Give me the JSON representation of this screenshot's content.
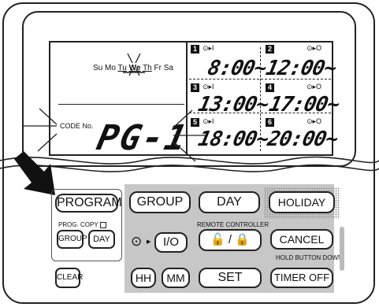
{
  "display": {
    "days": [
      "Su",
      "Mo",
      "Tu",
      "We",
      "Th",
      "Fr",
      "Sa"
    ],
    "code_label": "CODE No.",
    "program_code": "PG-1",
    "slots": [
      {
        "num": "1",
        "icon": "⊙▸I",
        "time": "8:00~"
      },
      {
        "num": "2",
        "icon": "⊙▸O",
        "time": "12:00~"
      },
      {
        "num": "3",
        "icon": "⊙▸I",
        "time": "13:00~"
      },
      {
        "num": "4",
        "icon": "⊙▸O",
        "time": "17:00~"
      },
      {
        "num": "5",
        "icon": "⊙▸I",
        "time": "18:00~"
      },
      {
        "num": "6",
        "icon": "⊙▸O",
        "time": "20:00~"
      }
    ]
  },
  "buttons": {
    "program": "PROGRAM",
    "prog_copy_label": "PROG. COPY",
    "group_small": "GROUP",
    "day_small": "DAY",
    "clear": "CLEAR",
    "group": "GROUP",
    "day": "DAY",
    "holiday": "HOLIDAY",
    "remote_controller_label": "REMOTE CONTROLLER",
    "timer_io": "I/O",
    "lock": "🔓 / 🔒",
    "cancel": "CANCEL",
    "hold_button_down_label": "HOLD BUTTON DOWN",
    "hh": "HH",
    "mm": "MM",
    "set": "SET",
    "timer_off": "TIMER OFF"
  }
}
